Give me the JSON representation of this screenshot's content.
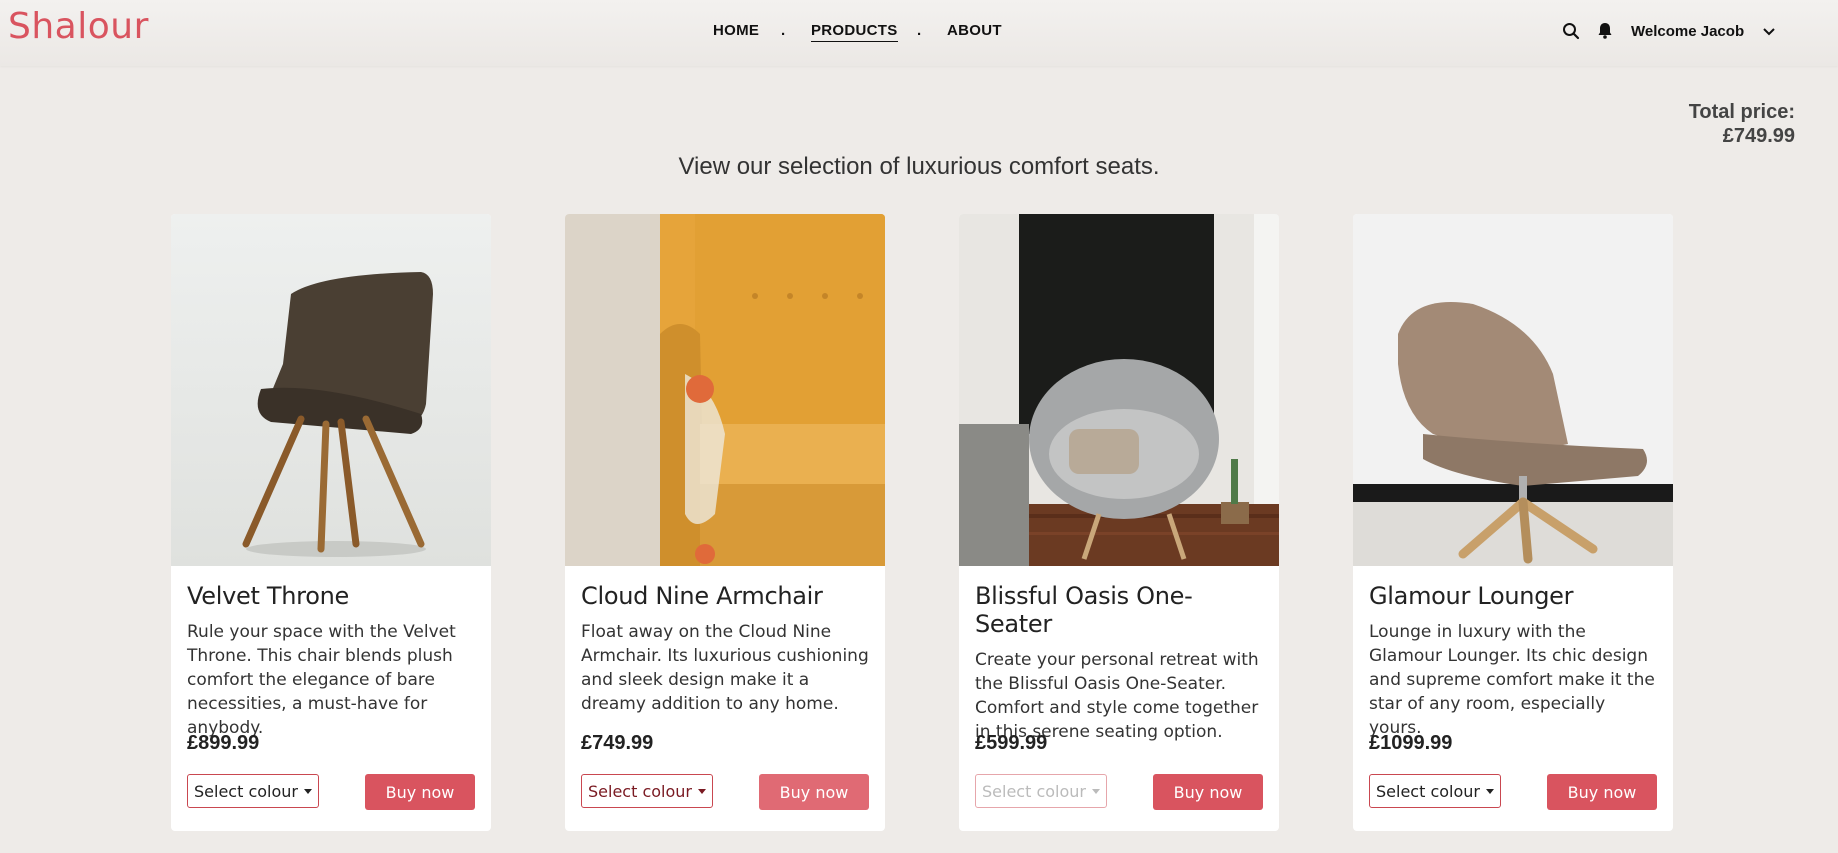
{
  "brand": {
    "name": "Shalour",
    "color": "#d9545f"
  },
  "nav": {
    "home": "HOME",
    "products": "PRODUCTS",
    "about": "ABOUT",
    "separator": ".",
    "active": "PRODUCTS"
  },
  "header": {
    "search_icon": "search-icon",
    "bell_icon": "bell-icon",
    "welcome": "Welcome Jacob",
    "menu_icon": "chevron-down-icon"
  },
  "cart": {
    "total_label": "Total price:",
    "total_value": "£749.99"
  },
  "page": {
    "subtitle": "View our selection of luxurious comfort seats."
  },
  "products": [
    {
      "title": "Velvet Throne",
      "description": "Rule your space with the Velvet Throne. This chair blends plush comfort the elegance of bare necessities, a must-have for anybody.",
      "price": "£899.99",
      "select_label": "Select colour",
      "buy_label": "Buy now"
    },
    {
      "title": "Cloud Nine Armchair",
      "description": "Float away on the Cloud Nine Armchair. Its luxurious cushioning and sleek design make it a dreamy addition to any home.",
      "price": "£749.99",
      "select_label": "Select colour",
      "buy_label": "Buy now"
    },
    {
      "title": "Blissful Oasis One-Seater",
      "description": "Create your personal retreat with the Blissful Oasis One-Seater. Comfort and style come together in this serene seating option.",
      "price": "£599.99",
      "select_label": "Select colour",
      "buy_label": "Buy now"
    },
    {
      "title": "Glamour Lounger",
      "description": "Lounge in luxury with the Glamour Lounger. Its chic design and supreme comfort make it the star of any room, especially yours.",
      "price": "£1099.99",
      "select_label": "Select colour",
      "buy_label": "Buy now"
    }
  ]
}
